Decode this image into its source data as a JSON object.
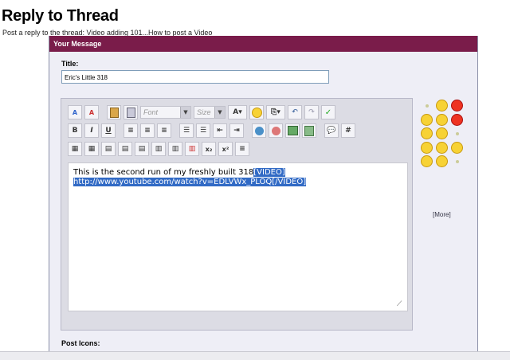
{
  "page": {
    "title": "Reply to Thread",
    "subtitle": "Post a reply to the thread: Video adding 101...How to post a Video"
  },
  "panel": {
    "header": "Your Message",
    "title_label": "Title:",
    "title_value": "Eric's Little 318",
    "post_icons_label": "Post Icons:",
    "more_link": "[More]"
  },
  "editor": {
    "font_combo": "Font",
    "size_combo": "Size",
    "bold": "B",
    "italic": "I",
    "underline": "U",
    "code": "#",
    "message_plain": "This is the second run of my freshly built 318",
    "message_selected_1": "[VIDEO]",
    "message_selected_2": "http://www.youtube.com/watch?v=EDLVWx_PLOQ[/VIDEO]"
  },
  "icons": {
    "font_color": "text-color-icon",
    "spell": "spellcheck-icon"
  }
}
